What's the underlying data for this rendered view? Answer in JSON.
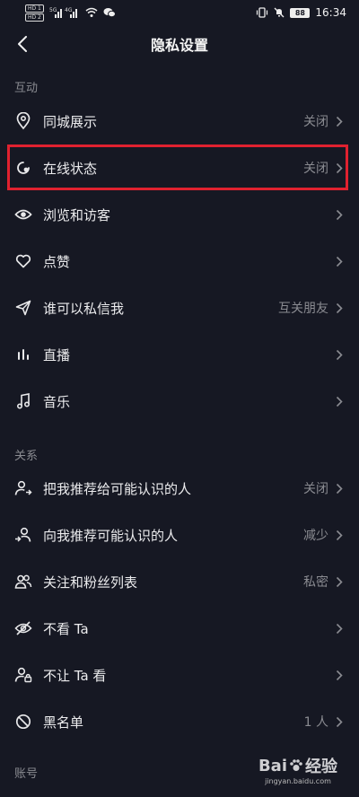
{
  "status_bar": {
    "hd1": "HD 1",
    "hd2": "HD 2",
    "signal_label": "5G",
    "signal_label2": "4G",
    "battery": "88",
    "time": "16:34"
  },
  "header": {
    "title": "隐私设置"
  },
  "sections": {
    "interaction": "互动",
    "relations": "关系",
    "account": "账号"
  },
  "rows": [
    {
      "label": "同城展示",
      "value": "关闭"
    },
    {
      "label": "在线状态",
      "value": "关闭"
    },
    {
      "label": "浏览和访客",
      "value": ""
    },
    {
      "label": "点赞",
      "value": ""
    },
    {
      "label": "谁可以私信我",
      "value": "互关朋友"
    },
    {
      "label": "直播",
      "value": ""
    },
    {
      "label": "音乐",
      "value": ""
    },
    {
      "label": "把我推荐给可能认识的人",
      "value": "关闭"
    },
    {
      "label": "向我推荐可能认识的人",
      "value": "减少"
    },
    {
      "label": "关注和粉丝列表",
      "value": "私密"
    },
    {
      "label": "不看 Ta",
      "value": ""
    },
    {
      "label": "不让 Ta 看",
      "value": ""
    },
    {
      "label": "黑名单",
      "value": "1 人"
    }
  ],
  "watermark": {
    "brand_left": "Bai",
    "brand_right": "经验",
    "url": "jingyan.baidu.com"
  },
  "colors": {
    "background": "#161823",
    "highlight": "#e0212f",
    "muted": "#8a8b91"
  }
}
